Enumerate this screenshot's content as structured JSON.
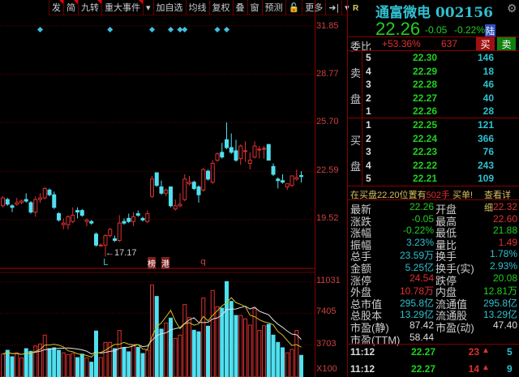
{
  "toolbar": {
    "items": [
      "发",
      "简",
      "九转",
      "重大事件",
      "▾",
      "加自选",
      "均线",
      "复权",
      "叠",
      "窗",
      "预测",
      "🔓",
      "更多",
      "➜|",
      "▾"
    ]
  },
  "axis": {
    "price": [
      "31.85",
      "28.77",
      "25.70",
      "22.59",
      "19.52"
    ],
    "volume": [
      "11031",
      "7405",
      "3703"
    ],
    "volume_unit": "X100"
  },
  "chart_annotations": {
    "low_label": "17.17",
    "marker_L": "L",
    "badge1": "榜",
    "badge2": "港",
    "marker_q": "q"
  },
  "chart_data": {
    "type": "candlestick",
    "price_range": [
      16.5,
      32.5
    ],
    "volume_range": [
      0,
      12000
    ],
    "ohlc": [
      [
        20.4,
        21.0,
        20.3,
        20.9
      ],
      [
        20.8,
        20.9,
        20.4,
        20.5
      ],
      [
        20.4,
        20.5,
        20.0,
        20.3
      ],
      [
        20.5,
        20.9,
        20.4,
        20.6
      ],
      [
        20.6,
        20.8,
        20.5,
        20.7
      ],
      [
        20.8,
        21.2,
        20.6,
        20.7
      ],
      [
        20.6,
        20.7,
        19.9,
        20.0
      ],
      [
        20.0,
        21.0,
        19.7,
        20.8
      ],
      [
        20.8,
        21.2,
        20.6,
        20.9
      ],
      [
        20.9,
        21.6,
        20.8,
        21.5
      ],
      [
        21.4,
        21.5,
        21.0,
        21.1
      ],
      [
        21.1,
        21.3,
        20.2,
        20.3
      ],
      [
        19.9,
        20.0,
        19.4,
        19.5
      ],
      [
        19.2,
        19.6,
        18.9,
        19.3
      ],
      [
        19.2,
        19.8,
        18.9,
        19.7
      ],
      [
        19.4,
        20.3,
        19.3,
        19.8
      ],
      [
        20.1,
        20.3,
        19.6,
        20.0
      ],
      [
        20.1,
        20.2,
        19.7,
        19.8
      ],
      [
        19.4,
        19.6,
        19.1,
        19.5
      ],
      [
        19.4,
        19.5,
        19.2,
        19.3
      ],
      [
        18.6,
        18.7,
        17.8,
        17.9
      ],
      [
        17.9,
        18.0,
        17.8,
        17.9
      ],
      [
        17.9,
        18.6,
        17.17,
        18.5
      ],
      [
        18.5,
        19.0,
        18.4,
        18.9
      ],
      [
        18.3,
        18.5,
        18.1,
        18.2
      ],
      [
        18.2,
        19.8,
        18.1,
        19.3
      ],
      [
        19.4,
        19.6,
        19.2,
        19.3
      ],
      [
        19.6,
        19.9,
        19.3,
        19.4
      ],
      [
        19.4,
        20.0,
        19.1,
        19.7
      ],
      [
        19.9,
        20.1,
        19.7,
        19.8
      ],
      [
        19.6,
        19.7,
        19.4,
        19.5
      ],
      [
        19.4,
        20.1,
        19.3,
        19.9
      ],
      [
        21.0,
        22.3,
        20.9,
        22.1
      ],
      [
        22.5,
        22.5,
        21.6,
        21.7
      ],
      [
        21.6,
        22.0,
        21.1,
        21.2
      ],
      [
        21.2,
        21.5,
        21.0,
        21.4
      ],
      [
        21.6,
        21.6,
        20.3,
        20.4
      ],
      [
        20.2,
        20.8,
        20.1,
        20.4
      ],
      [
        20.4,
        21.2,
        20.3,
        20.5
      ],
      [
        20.8,
        22.4,
        20.7,
        22.1
      ],
      [
        21.8,
        22.3,
        21.7,
        21.9
      ],
      [
        21.9,
        22.0,
        21.4,
        21.5
      ],
      [
        21.6,
        21.7,
        20.6,
        21.1
      ],
      [
        21.4,
        22.8,
        21.3,
        22.7
      ],
      [
        22.6,
        22.7,
        22.0,
        22.1
      ],
      [
        21.9,
        23.3,
        21.8,
        23.1
      ],
      [
        23.3,
        23.8,
        23.2,
        23.7
      ],
      [
        23.8,
        24.4,
        23.4,
        23.5
      ],
      [
        24.6,
        25.7,
        24.0,
        24.1
      ],
      [
        24.1,
        25.0,
        23.7,
        23.8
      ],
      [
        23.9,
        24.6,
        23.2,
        23.3
      ],
      [
        23.4,
        24.3,
        23.0,
        24.2
      ],
      [
        23.9,
        24.5,
        23.2,
        23.9
      ],
      [
        23.1,
        23.8,
        22.7,
        23.3
      ],
      [
        23.5,
        24.5,
        23.4,
        24.2
      ],
      [
        24.0,
        24.2,
        23.4,
        24.0
      ],
      [
        24.0,
        24.2,
        23.4,
        24.05
      ],
      [
        24.3,
        24.3,
        23.3,
        23.3
      ],
      [
        22.9,
        23.1,
        22.3,
        22.4
      ],
      [
        22.1,
        22.2,
        21.5,
        22.0
      ],
      [
        22.0,
        22.4,
        21.8,
        21.9
      ],
      [
        21.6,
        21.8,
        21.4,
        21.8
      ],
      [
        21.7,
        22.3,
        21.6,
        22.3
      ],
      [
        22.1,
        22.7,
        22.0,
        22.2
      ],
      [
        22.32,
        22.6,
        21.88,
        22.26
      ]
    ],
    "volume": [
      2660,
      3100,
      2350,
      2800,
      2220,
      3290,
      2980,
      3600,
      3830,
      4860,
      3290,
      3390,
      3100,
      2800,
      2600,
      2720,
      2250,
      2660,
      2220,
      1720,
      5330,
      2250,
      4010,
      4010,
      3290,
      5390,
      3390,
      2920,
      3700,
      3450,
      2720,
      3100,
      10650,
      9340,
      5550,
      6270,
      6830,
      4480,
      4860,
      8400,
      6890,
      5420,
      5240,
      9150,
      5890,
      10030,
      8150,
      7990,
      11060,
      8770,
      7140,
      7140,
      6740,
      6020,
      7930,
      5390,
      5950,
      6110,
      4860,
      4010,
      3390,
      2800,
      3200,
      5390,
      2510
    ],
    "event_marker_indices": [
      8,
      23,
      32,
      36,
      38,
      39,
      46,
      48
    ],
    "colors": {
      "up": "#e03030",
      "down": "#50e0f0",
      "ma5": "#d0c020",
      "ma10": "#e0e0e0"
    }
  },
  "quote": {
    "r_label": "R",
    "name": "通富微电",
    "code": "002156",
    "price": "22.26",
    "change": "-0.05",
    "pct": "-0.22%",
    "badge": "陆",
    "weibi_label": "委比",
    "weibi": "+53.36%",
    "weicha": "637",
    "buy_btn": "买",
    "sell_btn": "卖",
    "sell_label": [
      "卖",
      "盘"
    ],
    "buy_label": [
      "买",
      "盘"
    ],
    "asks": [
      {
        "n": "5",
        "p": "22.30",
        "v": "146"
      },
      {
        "n": "4",
        "p": "22.29",
        "v": "18"
      },
      {
        "n": "3",
        "p": "22.28",
        "v": "46"
      },
      {
        "n": "2",
        "p": "22.27",
        "v": "40"
      },
      {
        "n": "1",
        "p": "22.26",
        "v": "28"
      }
    ],
    "bids": [
      {
        "n": "1",
        "p": "22.25",
        "v": "121"
      },
      {
        "n": "2",
        "p": "22.24",
        "v": "366"
      },
      {
        "n": "3",
        "p": "22.23",
        "v": "76"
      },
      {
        "n": "4",
        "p": "22.22",
        "v": "243"
      },
      {
        "n": "5",
        "p": "22.21",
        "v": "109"
      }
    ],
    "notice": {
      "pre": "在买盘22.20位置有",
      "qty": "502手",
      "post": "买单!",
      "link": "查看详细"
    },
    "stats": [
      {
        "l1": "最新",
        "v1": "22.26",
        "c1": "g",
        "l2": "开盘",
        "v2": "22.32",
        "c2": "r"
      },
      {
        "l1": "涨跌",
        "v1": "-0.05",
        "c1": "g",
        "l2": "最高",
        "v2": "22.60",
        "c2": "r"
      },
      {
        "l1": "涨幅",
        "v1": "-0.22%",
        "c1": "g",
        "l2": "最低",
        "v2": "21.88",
        "c2": "g"
      },
      {
        "l1": "振幅",
        "v1": "3.23%",
        "c1": "c",
        "l2": "量比",
        "v2": "1.49",
        "c2": "r"
      },
      {
        "l1": "总手",
        "v1": "23.59万",
        "c1": "c",
        "l2": "换手",
        "v2": "1.78%",
        "c2": "c"
      },
      {
        "l1": "金额",
        "v1": "5.25亿",
        "c1": "c",
        "l2": "换手(实)",
        "v2": "2.93%",
        "c2": "c"
      },
      {
        "l1": "涨停",
        "v1": "24.54",
        "c1": "r",
        "l2": "跌停",
        "v2": "20.08",
        "c2": "g"
      },
      {
        "l1": "外盘",
        "v1": "10.78万",
        "c1": "r",
        "l2": "内盘",
        "v2": "12.81万",
        "c2": "g"
      },
      {
        "l1": "总市值",
        "v1": "295.8亿",
        "c1": "c",
        "l2": "流通值",
        "v2": "295.8亿",
        "c2": "c"
      },
      {
        "l1": "总股本",
        "v1": "13.29亿",
        "c1": "c",
        "l2": "流通股",
        "v2": "13.29亿",
        "c2": "c"
      },
      {
        "l1": "市盈(静)",
        "v1": "87.42",
        "c1": "w",
        "l2": "市盈(动)",
        "v2": "47.40",
        "c2": "w"
      },
      {
        "l1": "市盈(TTM)",
        "v1": "58.44",
        "c1": "w",
        "l2": "",
        "v2": "",
        "c2": "w"
      }
    ],
    "ticks": [
      {
        "t": "11:12",
        "p": "22.27",
        "v": "23",
        "n": "5"
      },
      {
        "t": "11:12",
        "p": "22.27",
        "v": "14",
        "n": "9"
      }
    ]
  }
}
